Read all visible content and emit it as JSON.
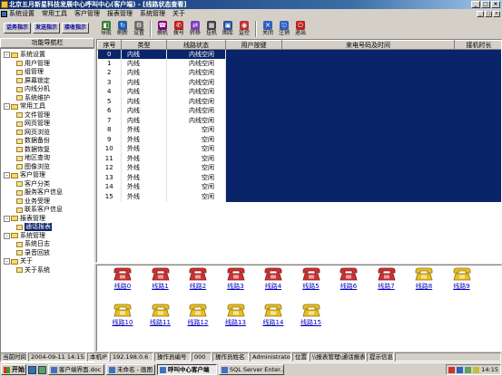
{
  "window": {
    "title": "北京五月新星科技发展中心呼叫中心(客户端) - [线路状态查看]",
    "controls": [
      "_",
      "□",
      "×"
    ]
  },
  "menu": {
    "items": [
      "系统设置",
      "常用工具",
      "客户管理",
      "报表管理",
      "系统管理",
      "关于"
    ]
  },
  "left": {
    "tab_buttons": [
      "话务指示",
      "发送指示",
      "接收指示"
    ],
    "nav_title": "功能导航栏",
    "tree": [
      {
        "label": "系统设置",
        "level": 0,
        "type": "folder",
        "expander": "-"
      },
      {
        "label": "用户管理",
        "level": 1,
        "type": "leaf"
      },
      {
        "label": "组管理",
        "level": 1,
        "type": "leaf"
      },
      {
        "label": "屏幕锁定",
        "level": 1,
        "type": "leaf"
      },
      {
        "label": "内线分机",
        "level": 1,
        "type": "leaf"
      },
      {
        "label": "系统维护",
        "level": 1,
        "type": "leaf"
      },
      {
        "label": "常用工具",
        "level": 0,
        "type": "folder",
        "expander": "-"
      },
      {
        "label": "文件管理",
        "level": 1,
        "type": "leaf"
      },
      {
        "label": "网页管理",
        "level": 1,
        "type": "leaf"
      },
      {
        "label": "网页浏览",
        "level": 1,
        "type": "leaf"
      },
      {
        "label": "数据备份",
        "level": 1,
        "type": "leaf"
      },
      {
        "label": "数据恢复",
        "level": 1,
        "type": "leaf"
      },
      {
        "label": "地区查询",
        "level": 1,
        "type": "leaf"
      },
      {
        "label": "图像浏览",
        "level": 1,
        "type": "leaf"
      },
      {
        "label": "客户管理",
        "level": 0,
        "type": "folder",
        "expander": "-"
      },
      {
        "label": "客户分类",
        "level": 1,
        "type": "leaf"
      },
      {
        "label": "服务客户信息",
        "level": 1,
        "type": "leaf"
      },
      {
        "label": "业务受理",
        "level": 1,
        "type": "leaf"
      },
      {
        "label": "联系客户信息",
        "level": 1,
        "type": "leaf"
      },
      {
        "label": "报表管理",
        "level": 0,
        "type": "folder",
        "expander": "-"
      },
      {
        "label": "通话报表",
        "level": 1,
        "type": "leaf",
        "selected": true
      },
      {
        "label": "系统管理",
        "level": 0,
        "type": "folder",
        "expander": "-"
      },
      {
        "label": "系统日志",
        "level": 1,
        "type": "leaf"
      },
      {
        "label": "录音回放",
        "level": 1,
        "type": "leaf"
      },
      {
        "label": "关于",
        "level": 0,
        "type": "folder",
        "expander": "-"
      },
      {
        "label": "关于系统",
        "level": 1,
        "type": "leaf"
      }
    ]
  },
  "toolbar": {
    "buttons": [
      {
        "label": "导航",
        "icon": "navigate-icon",
        "color": "#3a7d3a",
        "glyph": "◧"
      },
      {
        "label": "刷新",
        "icon": "refresh-icon",
        "color": "#2060b0",
        "glyph": "↻"
      },
      {
        "label": "设置",
        "icon": "settings-icon",
        "color": "#707070",
        "glyph": "⚙"
      },
      {
        "label": "摘机",
        "icon": "pickup-icon",
        "color": "#800080",
        "glyph": "☎"
      },
      {
        "label": "拨号",
        "icon": "dial-icon",
        "color": "#c02020",
        "glyph": "✆"
      },
      {
        "label": "转移",
        "icon": "transfer-icon",
        "color": "#8040c0",
        "glyph": "⇄"
      },
      {
        "label": "挂机",
        "icon": "hangup-icon",
        "color": "#404040",
        "glyph": "▦"
      },
      {
        "label": "图库",
        "icon": "gallery-icon",
        "color": "#2050a0",
        "glyph": "▣"
      },
      {
        "label": "监控",
        "icon": "monitor-icon",
        "color": "#c03030",
        "glyph": "◉"
      },
      {
        "label": "关闭",
        "icon": "close-icon",
        "color": "#3060c0",
        "glyph": "✕"
      },
      {
        "label": "注销",
        "icon": "logoff-icon",
        "color": "#3060c0",
        "glyph": "⎋"
      },
      {
        "label": "退出",
        "icon": "exit-icon",
        "color": "#c02020",
        "glyph": "⏻"
      }
    ]
  },
  "grid": {
    "columns": [
      "序号",
      "类型",
      "线路状态",
      "用户按键",
      "来电号码及时间",
      "接机时长"
    ],
    "rows": [
      [
        "0",
        "内线",
        "内线空闲",
        "",
        "",
        ""
      ],
      [
        "1",
        "内线",
        "内线空闲",
        "",
        "",
        ""
      ],
      [
        "2",
        "内线",
        "内线空闲",
        "",
        "",
        ""
      ],
      [
        "3",
        "内线",
        "内线空闲",
        "",
        "",
        ""
      ],
      [
        "4",
        "内线",
        "内线空闲",
        "",
        "",
        ""
      ],
      [
        "5",
        "内线",
        "内线空闲",
        "",
        "",
        ""
      ],
      [
        "6",
        "内线",
        "内线空闲",
        "",
        "",
        ""
      ],
      [
        "7",
        "内线",
        "内线空闲",
        "",
        "",
        ""
      ],
      [
        "8",
        "外线",
        "空闲",
        "",
        "",
        ""
      ],
      [
        "9",
        "外线",
        "空闲",
        "",
        "",
        ""
      ],
      [
        "10",
        "外线",
        "空闲",
        "",
        "",
        ""
      ],
      [
        "11",
        "外线",
        "空闲",
        "",
        "",
        ""
      ],
      [
        "12",
        "外线",
        "空闲",
        "",
        "",
        ""
      ],
      [
        "13",
        "外线",
        "空闲",
        "",
        "",
        ""
      ],
      [
        "14",
        "外线",
        "空闲",
        "",
        "",
        ""
      ],
      [
        "15",
        "外线",
        "空闲",
        "",
        "",
        ""
      ]
    ],
    "selected_row": 0
  },
  "phones": [
    {
      "label": "线路0",
      "color": "#d03030"
    },
    {
      "label": "线路1",
      "color": "#d03030"
    },
    {
      "label": "线路2",
      "color": "#d03030"
    },
    {
      "label": "线路3",
      "color": "#d03030"
    },
    {
      "label": "线路4",
      "color": "#d03030"
    },
    {
      "label": "线路5",
      "color": "#d03030"
    },
    {
      "label": "线路6",
      "color": "#d03030"
    },
    {
      "label": "线路7",
      "color": "#d03030"
    },
    {
      "label": "线路8",
      "color": "#e8c020"
    },
    {
      "label": "线路9",
      "color": "#e8c020"
    },
    {
      "label": "线路10",
      "color": "#e8c020"
    },
    {
      "label": "线路11",
      "color": "#e8c020"
    },
    {
      "label": "线路12",
      "color": "#e8c020"
    },
    {
      "label": "线路13",
      "color": "#e8c020"
    },
    {
      "label": "线路14",
      "color": "#e8c020"
    },
    {
      "label": "线路15",
      "color": "#e8c020"
    }
  ],
  "status": {
    "current_time_label": "当前时间",
    "current_time": "2004-09-11 14:15:21",
    "ip_label": "本机IP",
    "ip": "192.198.0.6",
    "operator_no_label": "操作员编号",
    "operator_no": "000",
    "operator_name_label": "操作员姓名",
    "operator_name": "Administrator",
    "location_label": "位置",
    "location": "\\\\报表管理\\通话报表",
    "tip_label": "提示信息"
  },
  "taskbar": {
    "start": "开始",
    "tasks": [
      {
        "label": "客户端界面.doc ...",
        "active": false
      },
      {
        "label": "未命名 - 画图",
        "active": false
      },
      {
        "label": "呼叫中心客户端",
        "active": true
      },
      {
        "label": "SQL Server Enter...",
        "active": false
      }
    ],
    "clock": "14:15"
  }
}
